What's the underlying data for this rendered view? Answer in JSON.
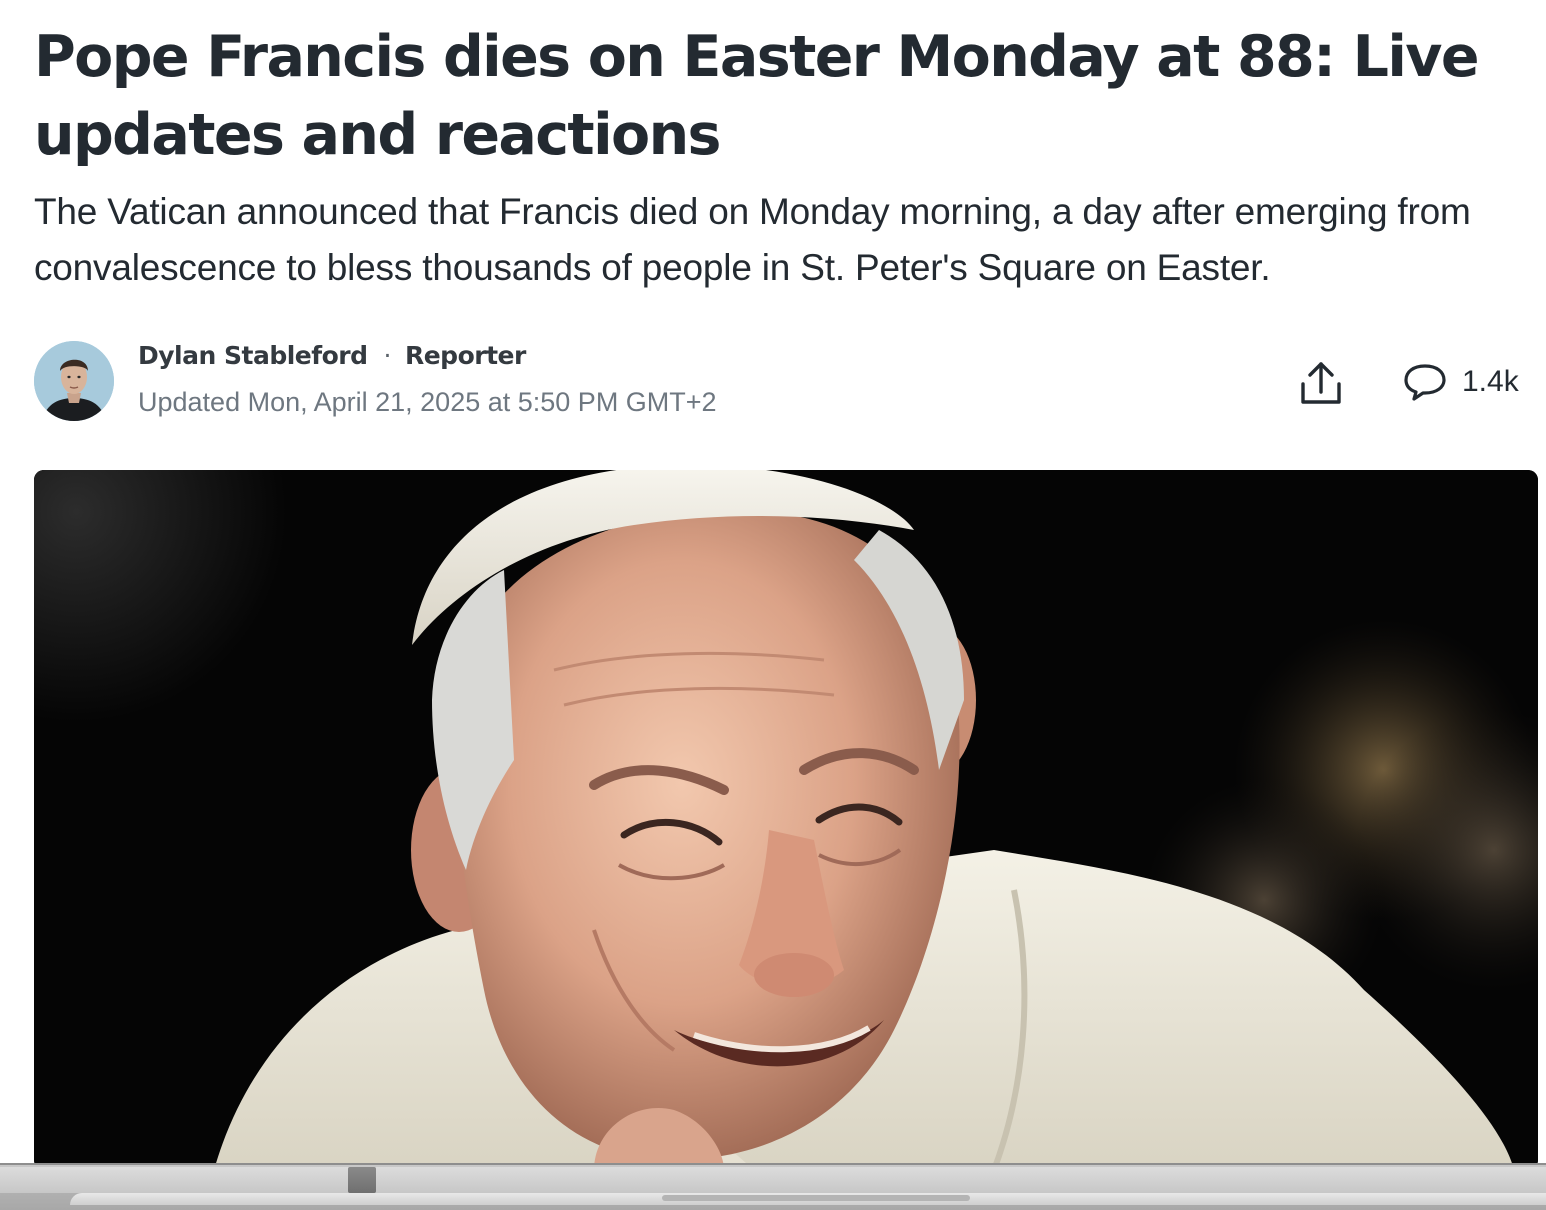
{
  "article": {
    "headline": "Pope Francis dies on Easter Monday at 88: Live updates and reactions",
    "subheadline": "The Vatican announced that Francis died on Monday morning, a day after emerging from convalescence to bless thousands of people in St. Peter's Square on Easter.",
    "author": {
      "name": "Dylan Stableford",
      "separator": "·",
      "role": "Reporter"
    },
    "updated": "Updated Mon, April 21, 2025 at 5:50 PM GMT+2",
    "actions": {
      "share_icon": "share-icon",
      "comments_icon": "comment-icon",
      "comment_count": "1.4k"
    }
  },
  "colors": {
    "headline": "#232a31",
    "meta_gray": "#6e7780",
    "hero_background": "#050505"
  }
}
